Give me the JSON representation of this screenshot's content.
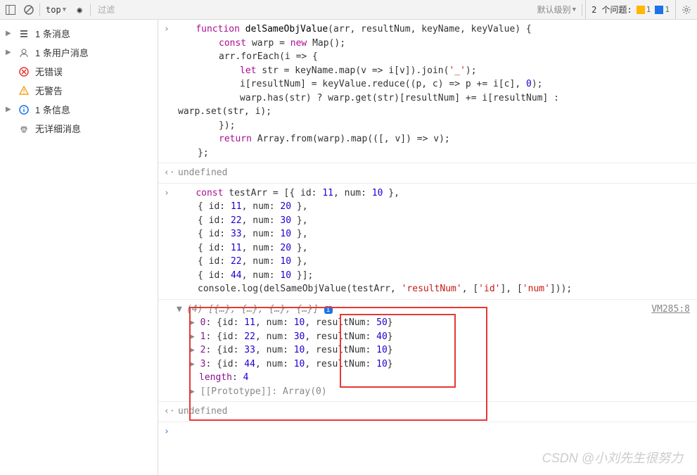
{
  "toolbar": {
    "context": "top",
    "filterPlaceholder": "过滤",
    "logLevel": "默认级别",
    "issuesLabel": "2 个问题:",
    "warnCount": "1",
    "infoCount": "1"
  },
  "sidebar": {
    "items": [
      {
        "label": "1 条消息",
        "arrow": "▶",
        "iconType": "list"
      },
      {
        "label": "1 条用户消息",
        "arrow": "▶",
        "iconType": "user"
      },
      {
        "label": "无错误",
        "arrow": "",
        "iconType": "error"
      },
      {
        "label": "无警告",
        "arrow": "",
        "iconType": "warn"
      },
      {
        "label": "1 条信息",
        "arrow": "▶",
        "iconType": "info"
      },
      {
        "label": "无详细消息",
        "arrow": "",
        "iconType": "bug"
      }
    ]
  },
  "code1": {
    "l1a": "function",
    "l1b": " ",
    "l1c": "delSameObjValue",
    "l1d": "(arr, resultNum, keyName, keyValue) {",
    "l2a": "const",
    "l2b": " warp = ",
    "l2c": "new",
    "l2d": " Map();",
    "l3": "arr.forEach(i => {",
    "l4a": "let",
    "l4b": " str = keyName.map(v => i[v]).join(",
    "l4c": "'_'",
    "l4d": ");",
    "l5a": "i[resultNum] = keyValue.reduce((p, c) => p += i[c], ",
    "l5b": "0",
    "l5c": ");",
    "l6": "warp.has(str) ? warp.get(str)[resultNum] += i[resultNum] : ",
    "l7": "warp.set(str, i);",
    "l8": "});",
    "l9a": "return",
    "l9b": " Array.from(warp).map(([, v]) => v);",
    "l10": "};"
  },
  "undef1": "undefined",
  "code2": {
    "l1a": "const",
    "l1b": " testArr = [{ id: ",
    "l1c": "11",
    "l1d": ", num: ",
    "l1e": "10",
    "l1f": " },",
    "r": [
      {
        "id": "11",
        "num": "20"
      },
      {
        "id": "22",
        "num": "30"
      },
      {
        "id": "33",
        "num": "10"
      },
      {
        "id": "11",
        "num": "20"
      },
      {
        "id": "22",
        "num": "10"
      },
      {
        "id": "44",
        "num": "10"
      }
    ],
    "tail": "];",
    "log1": "console.log(delSameObjValue(testArr, ",
    "log2": "'resultNum'",
    "log3": ", [",
    "log4": "'id'",
    "log5": "], [",
    "log6": "'num'",
    "log7": "]));"
  },
  "result": {
    "header": "(4) [{…}, {…}, {…}, {…}]",
    "source": "VM285:8",
    "rows": [
      {
        "idx": "0",
        "id": "11",
        "num": "10",
        "rn": "50"
      },
      {
        "idx": "1",
        "id": "22",
        "num": "30",
        "rn": "40"
      },
      {
        "idx": "2",
        "id": "33",
        "num": "10",
        "rn": "10"
      },
      {
        "idx": "3",
        "id": "44",
        "num": "10",
        "rn": "10"
      }
    ],
    "lenLabel": "length",
    "lenVal": "4",
    "proto": "[[Prototype]]: Array(0)"
  },
  "undef2": "undefined",
  "watermark": "CSDN @小刘先生很努力"
}
